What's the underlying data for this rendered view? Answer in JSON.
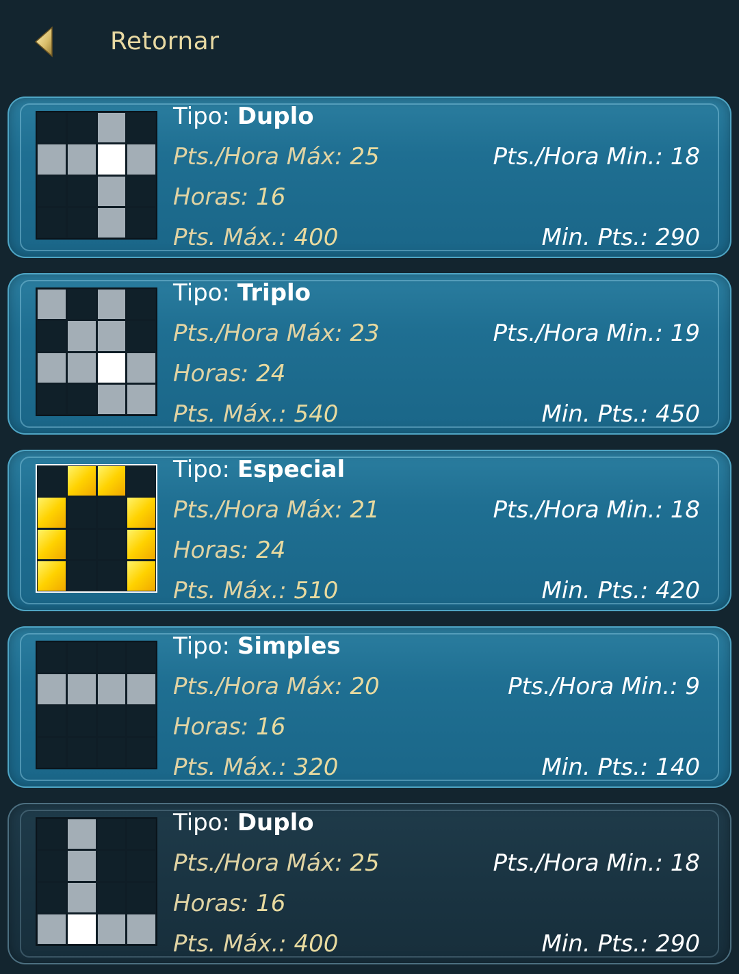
{
  "header": {
    "back_label": "Retornar"
  },
  "labels": {
    "type": "Tipo:",
    "max_per_hour": "Pts./Hora Máx:",
    "min_per_hour": "Pts./Hora Min.:",
    "hours": "Horas:",
    "max_points": "Pts. Máx.:",
    "min_points": "Min. Pts.:"
  },
  "colors": {
    "background": "#13252f",
    "card": "#1f6f92",
    "card_selected": "#1a3442",
    "label_gold": "#e0d3a3",
    "cell_grey": "#a3aeb6",
    "cell_yellow": "#ffd200"
  },
  "cards": [
    {
      "type": "Duplo",
      "max_per_hour": "25",
      "min_per_hour": "18",
      "hours": "16",
      "max_points": "400",
      "min_points": "290",
      "pattern": [
        "..g.",
        "ggwg",
        "..g.",
        "..g."
      ]
    },
    {
      "type": "Triplo",
      "max_per_hour": "23",
      "min_per_hour": "19",
      "hours": "24",
      "max_points": "540",
      "min_points": "450",
      "pattern": [
        "g.g.",
        ".gg.",
        "ggwg",
        "..gg"
      ]
    },
    {
      "type": "Especial",
      "max_per_hour": "21",
      "min_per_hour": "18",
      "hours": "24",
      "max_points": "510",
      "min_points": "420",
      "pattern": [
        ".yy.",
        "y..y",
        "y..y",
        "y..y"
      ]
    },
    {
      "type": "Simples",
      "max_per_hour": "20",
      "min_per_hour": "9",
      "hours": "16",
      "max_points": "320",
      "min_points": "140",
      "pattern": [
        "....",
        "gggg",
        "....",
        "...."
      ]
    },
    {
      "type": "Duplo",
      "max_per_hour": "25",
      "min_per_hour": "18",
      "hours": "16",
      "max_points": "400",
      "min_points": "290",
      "pattern": [
        ".g..",
        ".g..",
        ".g..",
        "gwgg"
      ]
    }
  ]
}
